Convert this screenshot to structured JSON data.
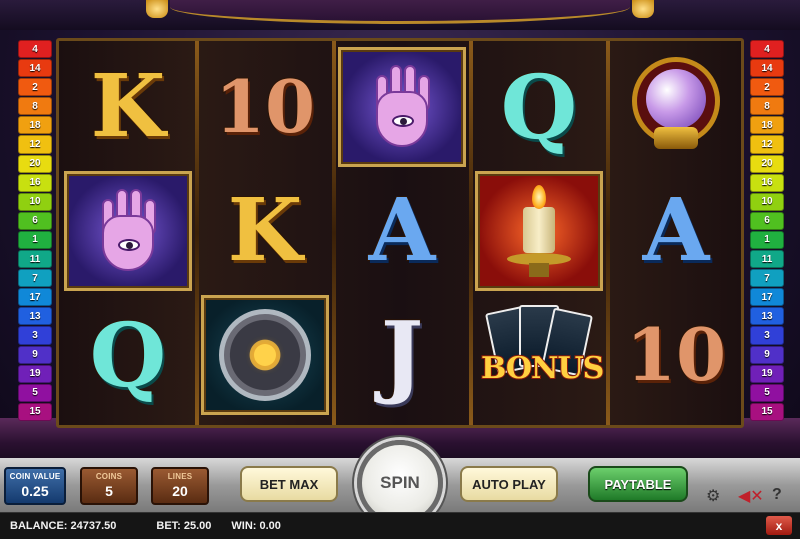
{
  "line_indicators": {
    "left": [
      "4",
      "14",
      "2",
      "8",
      "18",
      "12",
      "20",
      "16",
      "10",
      "6",
      "1",
      "11",
      "7",
      "17",
      "13",
      "3",
      "9",
      "19",
      "5",
      "15"
    ],
    "right": [
      "4",
      "14",
      "2",
      "8",
      "18",
      "12",
      "20",
      "16",
      "10",
      "6",
      "1",
      "11",
      "7",
      "17",
      "13",
      "3",
      "9",
      "19",
      "5",
      "15"
    ]
  },
  "reels": [
    [
      "K",
      "palm",
      "Q"
    ],
    [
      "10",
      "K",
      "zodiac"
    ],
    [
      "palm",
      "A",
      "J"
    ],
    [
      "Q",
      "candle",
      "bonus"
    ],
    [
      "crystal-ball",
      "A",
      "10"
    ]
  ],
  "bonus_label": "BONUS",
  "controls": {
    "coin_value": {
      "label": "COIN VALUE",
      "value": "0.25"
    },
    "coins": {
      "label": "COINS",
      "value": "5"
    },
    "lines": {
      "label": "LINES",
      "value": "20"
    },
    "bet_max": "BET MAX",
    "spin": "SPIN",
    "auto_play": "AUTO PLAY",
    "paytable": "PAYTABLE",
    "help": "?",
    "close": "x"
  },
  "status": {
    "balance": "BALANCE: 24737.50",
    "bet": "BET: 25.00",
    "win": "WIN: 0.00"
  },
  "icons": [
    "gear-icon",
    "mute-icon",
    "help-icon",
    "close-icon"
  ],
  "colors": {
    "spin_text": "#555555",
    "paytable": "#2e9a3a",
    "coin_value_bg": "#1f4f8e"
  }
}
